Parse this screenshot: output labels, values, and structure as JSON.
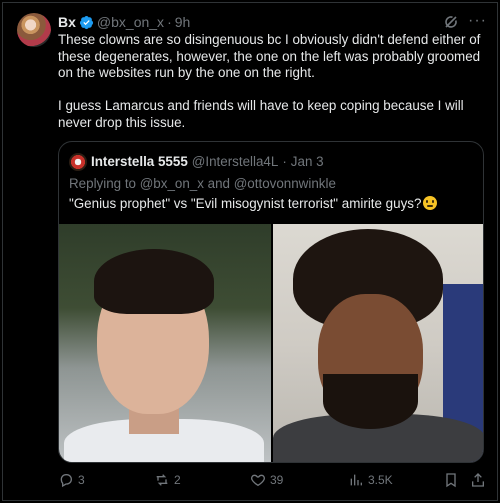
{
  "tweet": {
    "display_name": "Bx",
    "handle": "@bx_on_x",
    "dot": "·",
    "time": "9h",
    "icons": {
      "verified": "verified-badge-icon",
      "grok": "grok-icon",
      "more": "more-icon"
    },
    "paragraphs": [
      "These clowns are so disingenuous bc I obviously didn't defend either of these degenerates, however, the one on the left was probably groomed on the websites run by the one on the right.",
      "I guess Lamarcus and friends will have to keep coping because I will never drop this issue."
    ]
  },
  "quote": {
    "display_name": "Interstella 5555",
    "handle": "@Interstella4L",
    "dot": "·",
    "time": "Jan 3",
    "reply_prefix": "Replying to @bx_on_x and @ottovonnwinkle",
    "text": "\"Genius prophet\" vs \"Evil misogynist terrorist\" amirite guys?",
    "emoji": "grimacing-face-emoji"
  },
  "actions": {
    "replies": "3",
    "reposts": "2",
    "likes": "39",
    "views": "3.5K"
  },
  "colors": {
    "background": "#000000",
    "text": "#e7e9ea",
    "muted": "#71767b",
    "border": "#2f3336",
    "verified": "#1d9bf0"
  }
}
